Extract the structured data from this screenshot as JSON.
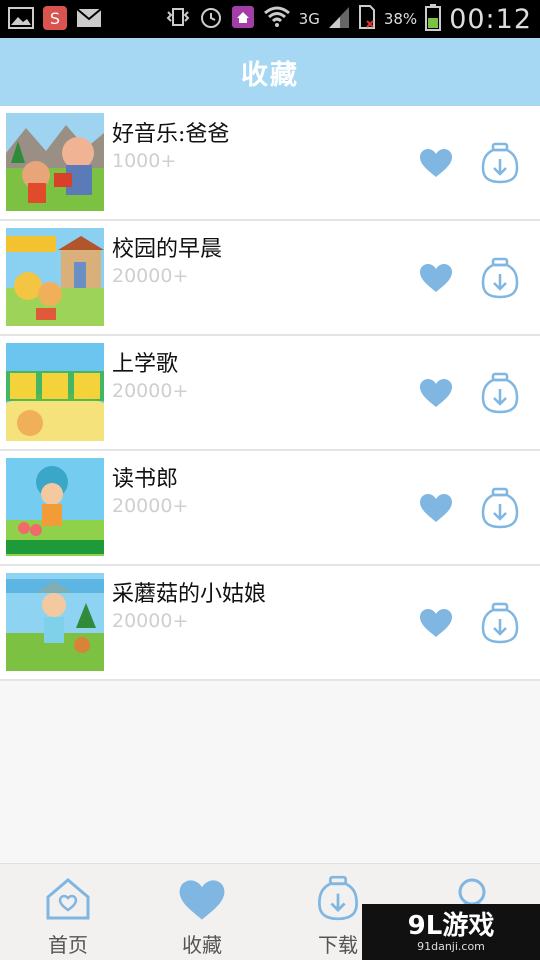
{
  "status_bar": {
    "network": "3G",
    "battery": "38%",
    "time": "00:12",
    "icons": [
      "gallery-icon",
      "sohu-icon",
      "mail-icon",
      "vibrate-icon",
      "alarm-icon",
      "home-app-icon",
      "wifi-icon",
      "signal-icon",
      "sim-icon",
      "battery-icon"
    ]
  },
  "header": {
    "title": "收藏"
  },
  "items": [
    {
      "title": "好音乐:爸爸",
      "count": "1000+"
    },
    {
      "title": "校园的早晨",
      "count": "20000+"
    },
    {
      "title": "上学歌",
      "count": "20000+"
    },
    {
      "title": "读书郎",
      "count": "20000+"
    },
    {
      "title": "采蘑菇的小姑娘",
      "count": "20000+"
    }
  ],
  "nav": [
    {
      "label": "首页",
      "icon": "home-icon"
    },
    {
      "label": "收藏",
      "icon": "heart-icon"
    },
    {
      "label": "下载",
      "icon": "download-icon"
    },
    {
      "label": "",
      "icon": "user-icon"
    }
  ],
  "watermark": {
    "logo": "9L游戏",
    "sub": "91danji.com"
  },
  "colors": {
    "header": "#a6d8f3",
    "accent": "#7fb6e2",
    "count_text": "#cfcfcf"
  }
}
